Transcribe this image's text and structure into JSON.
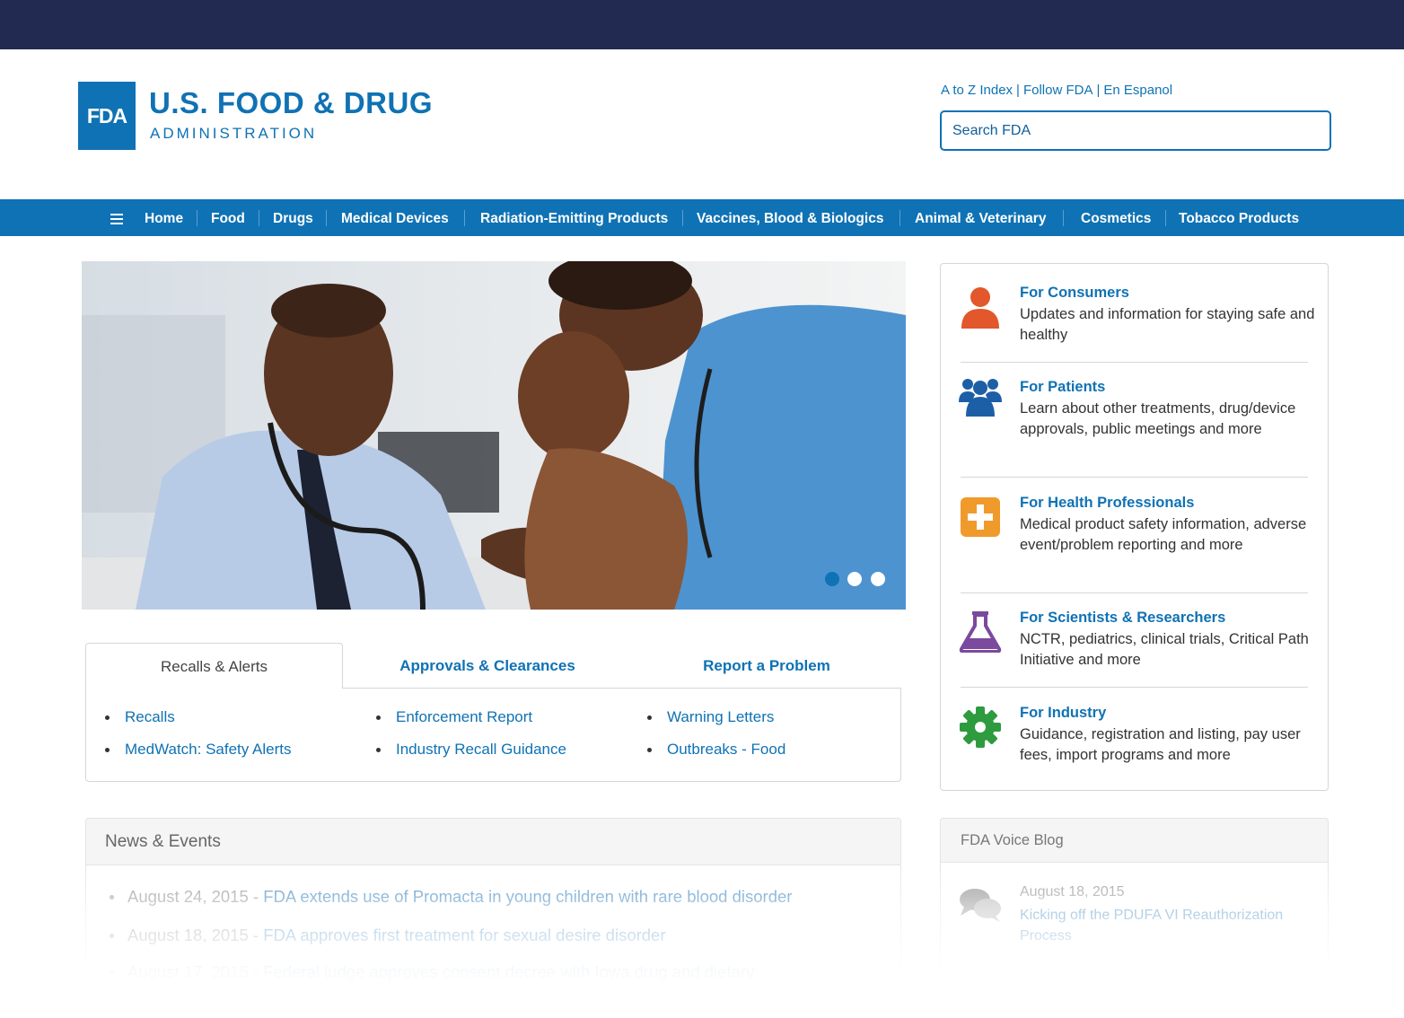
{
  "header": {
    "logo_mark": "FDA",
    "logo_title": "U.S. FOOD & DRUG",
    "logo_subtitle": "ADMINISTRATION",
    "utility_links": [
      "A to Z Index",
      "Follow FDA",
      "En Espanol"
    ],
    "search_placeholder": "Search FDA"
  },
  "nav": {
    "menu_icon": "hamburger-menu-icon",
    "items": [
      "Home",
      "Food",
      "Drugs",
      "Medical Devices",
      "Radiation-Emitting Products",
      "Vaccines, Blood & Biologics",
      "Animal & Veterinary",
      "Cosmetics",
      "Tobacco Products"
    ]
  },
  "carousel": {
    "slides": 3,
    "active_slide": 1,
    "active_dot_color": "#0f72b4"
  },
  "tabs": {
    "labels": [
      "Recalls & Alerts",
      "Approvals & Clearances",
      "Report a Problem"
    ],
    "active": "Recalls & Alerts",
    "links": [
      [
        "Recalls",
        "MedWatch: Safety Alerts"
      ],
      [
        "Enforcement Report",
        "Industry Recall Guidance"
      ],
      [
        "Warning Letters",
        "Outbreaks - Food"
      ]
    ]
  },
  "audiences": [
    {
      "title": "For Consumers",
      "desc": "Updates and information for staying safe and healthy",
      "icon": "person-icon",
      "color": "#e2572b"
    },
    {
      "title": "For Patients",
      "desc": "Learn about other treatments, drug/device approvals, public meetings and more",
      "icon": "group-icon",
      "color": "#1d5fa6"
    },
    {
      "title": "For Health Professionals",
      "desc": "Medical product safety information, adverse event/problem reporting and more",
      "icon": "plus-icon",
      "color": "#f19a2c"
    },
    {
      "title": "For Scientists & Researchers",
      "desc": "NCTR, pediatrics, clinical trials, Critical Path Initiative and more",
      "icon": "flask-icon",
      "color": "#7b4a9e"
    },
    {
      "title": "For Industry",
      "desc": "Guidance, registration and listing, pay user fees, import programs and more",
      "icon": "gear-icon",
      "color": "#2e9b3e"
    }
  ],
  "news": {
    "title": "News & Events",
    "items": [
      {
        "date": "August 24, 2015",
        "text": "FDA extends use of Promacta in young children with rare blood disorder"
      },
      {
        "date": "August 18, 2015",
        "text": "FDA approves first treatment for sexual desire disorder"
      },
      {
        "date": "August 17, 2015",
        "text": "Federal judge approves consent decree with Iowa drug and dietary"
      }
    ]
  },
  "blog": {
    "title": "FDA Voice Blog",
    "date": "August 18, 2015",
    "post": "Kicking off the PDUFA VI Reauthorization Process",
    "icon": "speech-bubbles-icon"
  }
}
